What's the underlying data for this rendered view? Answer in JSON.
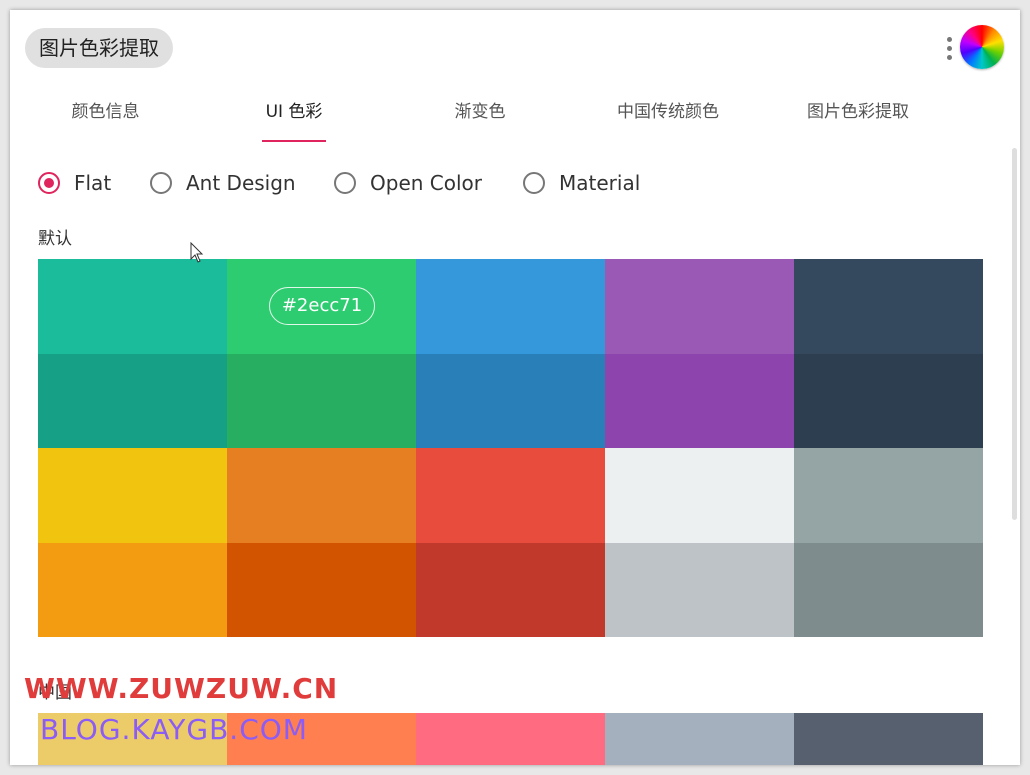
{
  "app": {
    "title": "图片色彩提取"
  },
  "header": {
    "menu_icon": "more-vert-icon",
    "logo_icon": "color-wheel-icon"
  },
  "tabs": [
    {
      "label": "颜色信息",
      "active": false
    },
    {
      "label": "UI 色彩",
      "active": true
    },
    {
      "label": "渐变色",
      "active": false
    },
    {
      "label": "中国传统颜色",
      "active": false
    },
    {
      "label": "图片色彩提取",
      "active": false
    }
  ],
  "palette_options": [
    {
      "label": "Flat",
      "selected": true
    },
    {
      "label": "Ant Design",
      "selected": false
    },
    {
      "label": "Open Color",
      "selected": false
    },
    {
      "label": "Material",
      "selected": false
    }
  ],
  "sections": [
    {
      "title": "默认",
      "rows": [
        [
          "#1abc9c",
          "#2ecc71",
          "#3498db",
          "#9b59b6",
          "#34495e"
        ],
        [
          "#16a085",
          "#27ae60",
          "#2980b9",
          "#8e44ad",
          "#2c3e50"
        ],
        [
          "#f1c40f",
          "#e67e22",
          "#e74c3c",
          "#ecf0f1",
          "#95a5a6"
        ],
        [
          "#f39c12",
          "#d35400",
          "#c0392b",
          "#bdc3c7",
          "#7f8c8d"
        ]
      ],
      "hover_hex": "#2ecc71"
    },
    {
      "title": "中国",
      "rows": [
        [
          "#eccc68",
          "#ff7f50",
          "#ff6b81",
          "#a4b0be",
          "#57606f"
        ]
      ]
    }
  ],
  "watermarks": {
    "line1": "WWW.ZUWZUW.CN",
    "line2": "BLOG.KAYGB.COM"
  },
  "colors": {
    "accent": "#e0245e",
    "chip_bg": "#e0e0e0"
  }
}
